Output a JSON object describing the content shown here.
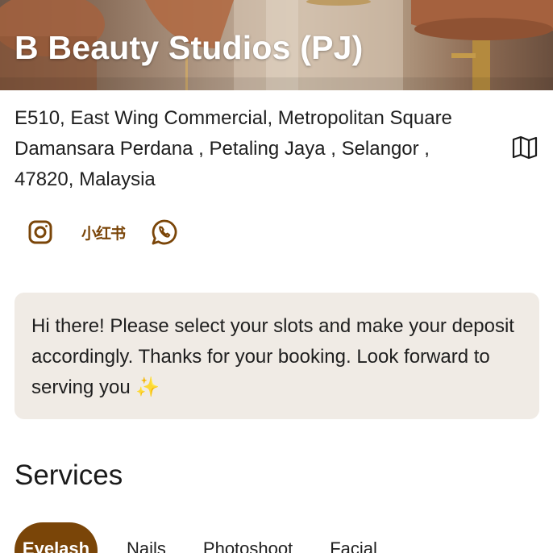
{
  "business": {
    "name": "B Beauty Studios (PJ)",
    "address_lines": [
      "E510, East Wing Commercial, Metropolitan Square",
      "Damansara Perdana , Petaling Jaya , Selangor ,",
      "47820, Malaysia"
    ],
    "map_icon": "map-icon"
  },
  "social": {
    "instagram_icon": "instagram-icon",
    "xiaohongshu_label": "小红书",
    "whatsapp_icon": "whatsapp-icon"
  },
  "notice": {
    "message": "Hi there! Please select your slots and make your deposit accordingly. Thanks for your booking. Look forward to serving you ✨"
  },
  "services": {
    "title": "Services",
    "tabs": [
      {
        "label": "Eyelash",
        "active": true
      },
      {
        "label": "Nails",
        "active": false
      },
      {
        "label": "Photoshoot",
        "active": false
      },
      {
        "label": "Facial",
        "active": false
      }
    ]
  },
  "colors": {
    "brand": "#7a4508",
    "notice_bg": "#f0ebe5",
    "text": "#1f1f1f"
  }
}
